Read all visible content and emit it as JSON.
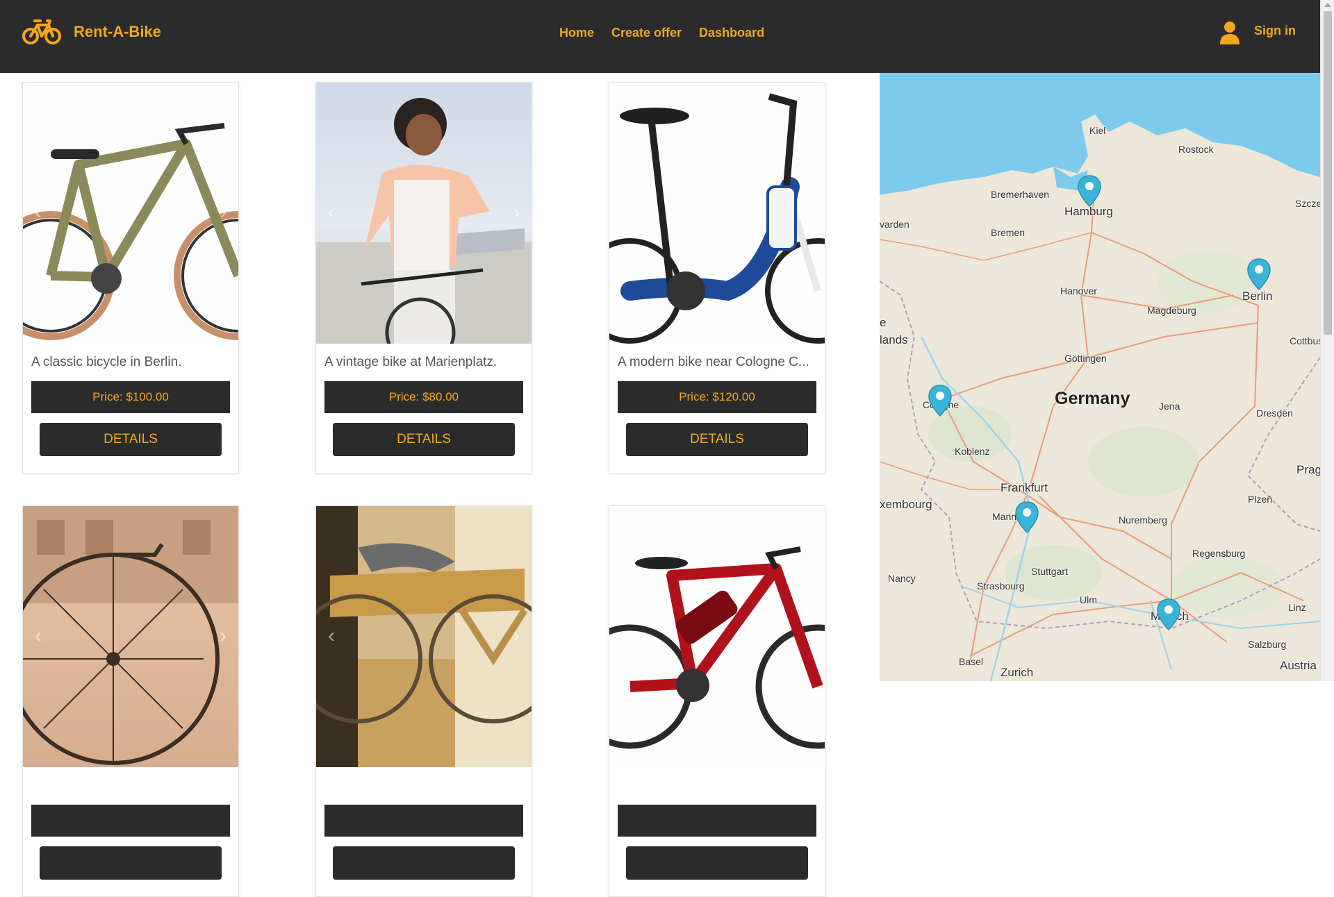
{
  "header": {
    "brand": "Rent-A-Bike",
    "nav": [
      {
        "label": "Home"
      },
      {
        "label": "Create offer"
      },
      {
        "label": "Dashboard"
      }
    ],
    "signin_label": "Sign in"
  },
  "listings": [
    {
      "description": "A classic bicycle in Berlin.",
      "price": "Price: $100.00",
      "details_label": "DETAILS"
    },
    {
      "description": "A vintage bike at Marienplatz.",
      "price": "Price: $80.00",
      "details_label": "DETAILS"
    },
    {
      "description": "A modern bike near Cologne C...",
      "price": "Price: $120.00",
      "details_label": "DETAILS"
    },
    {
      "description": "",
      "price": "",
      "details_label": ""
    },
    {
      "description": "",
      "price": "",
      "details_label": ""
    },
    {
      "description": "",
      "price": "",
      "details_label": ""
    }
  ],
  "map": {
    "country_label": "Germany",
    "cities": [
      "Kiel",
      "Rostock",
      "Bremerhaven",
      "Hamburg",
      "Bremen",
      "Hanover",
      "Magdeburg",
      "Berlin",
      "Göttingen",
      "Cologne",
      "Jena",
      "Dresden",
      "Koblenz",
      "Frankfurt",
      "Mannheim",
      "Nuremberg",
      "Stuttgart",
      "Regensburg",
      "Plzeň",
      "Prague",
      "Nancy",
      "Strasbourg",
      "Ulm",
      "Munich",
      "Linz",
      "Salzburg",
      "Basel",
      "Zurich",
      "Austria",
      "Szczecin",
      "Cottbus",
      "lands",
      "xembourg",
      "varden",
      "e"
    ],
    "markers": [
      "Hamburg",
      "Berlin",
      "Cologne",
      "Mannheim",
      "Munich"
    ]
  },
  "colors": {
    "accent": "#f4a61d",
    "navbar": "#2b2b2b",
    "sea": "#7ccbed",
    "land": "#ece7d8",
    "marker": "#3bb4d9"
  }
}
